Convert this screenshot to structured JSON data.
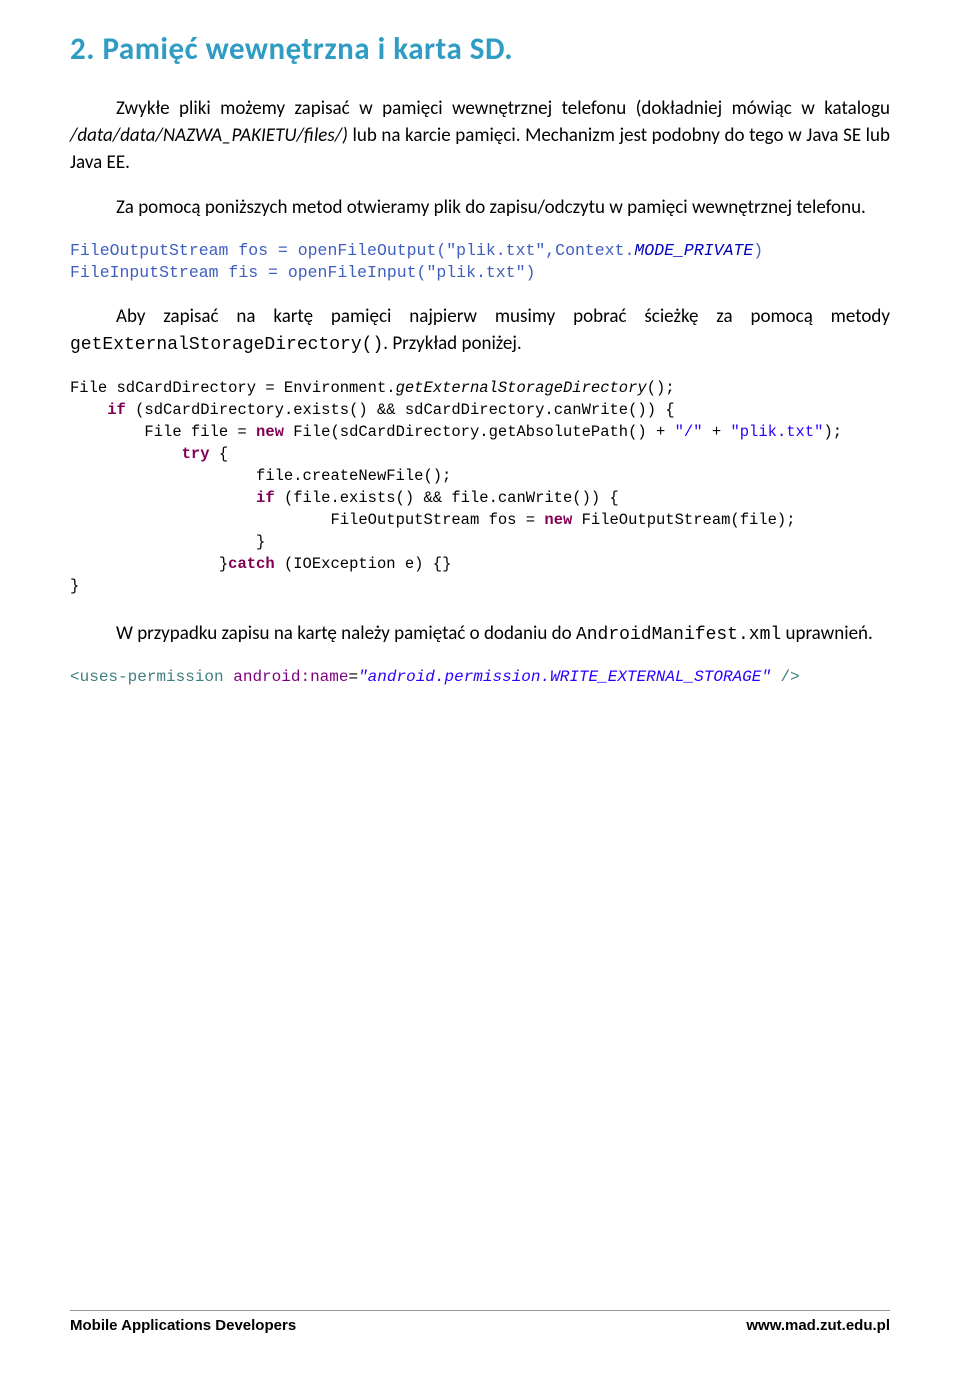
{
  "section": {
    "title": "2.    Pamięć wewnętrzna i karta SD."
  },
  "paragraphs": {
    "p1_a": "Zwykłe pliki możemy zapisać w pamięci wewnętrznej telefonu (dokładniej mówiąc w katalogu ",
    "p1_italic": "/data/data/NAZWA_PAKIETU/files/)",
    "p1_b": " lub na karcie pamięci. Mechanizm jest podobny do tego w Java SE lub Java EE.",
    "p2": "Za pomocą poniższych metod otwieramy plik do zapisu/odczytu w pamięci wewnętrznej telefonu.",
    "p3_a": "Aby zapisać na kartę pamięci najpierw musimy pobrać  ścieżkę za pomocą metody ",
    "p3_mono": "getExternalStorageDirectory()",
    "p3_b": ". Przykład poniżej.",
    "p4_a": "W przypadku zapisu na kartę należy pamiętać o dodaniu do ",
    "p4_mono": "AndroidManifest.xml",
    "p4_b": "  uprawnień."
  },
  "code1": {
    "l1_a": "FileOutputStream fos = openFileOutput(\"plik.txt\",Context.",
    "l1_b": "MODE_PRIVATE",
    "l1_c": ")",
    "l2": "FileInputStream fis = openFileInput(\"plik.txt\")"
  },
  "java": {
    "l1_a": "File sdCardDirectory = Environment.",
    "l1_b": "getExternalStorageDirectory",
    "l1_c": "();",
    "l2_indent": "    ",
    "l2_if": "if",
    "l2_a": " (sdCardDirectory.exists() && sdCardDirectory.canWrite()) {",
    "l3_indent": "        ",
    "l3_a": "File file = ",
    "l3_new": "new",
    "l3_b": " File(sdCardDirectory.getAbsolutePath() + ",
    "l3_s1": "\"/\"",
    "l3_c": " + ",
    "l3_s2": "\"plik.txt\"",
    "l3_d": ");",
    "l4_indent": "            ",
    "l4_try": "try",
    "l4_a": " {",
    "l5_indent": "                    ",
    "l5_a": "file.createNewFile();",
    "l6_indent": "                    ",
    "l6_if": "if",
    "l6_a": " (file.exists() && file.canWrite()) {",
    "l7_indent": "                            ",
    "l7_a": "FileOutputStream fos = ",
    "l7_new": "new",
    "l7_b": " FileOutputStream(file);",
    "l8_indent": "                    ",
    "l8_a": "}",
    "l9_indent": "                ",
    "l9_a": "}",
    "l9_catch": "catch",
    "l9_b": " (IOException e) {}",
    "l10": "}"
  },
  "xml": {
    "open": "<",
    "tag": "uses-permission",
    "sp": " ",
    "attr_name": "android:name",
    "eq": "=",
    "attr_val": "\"android.permission.WRITE_EXTERNAL_STORAGE\"",
    "close": " />"
  },
  "footer": {
    "left": "Mobile Applications Developers",
    "right": "www.mad.zut.edu.pl"
  }
}
